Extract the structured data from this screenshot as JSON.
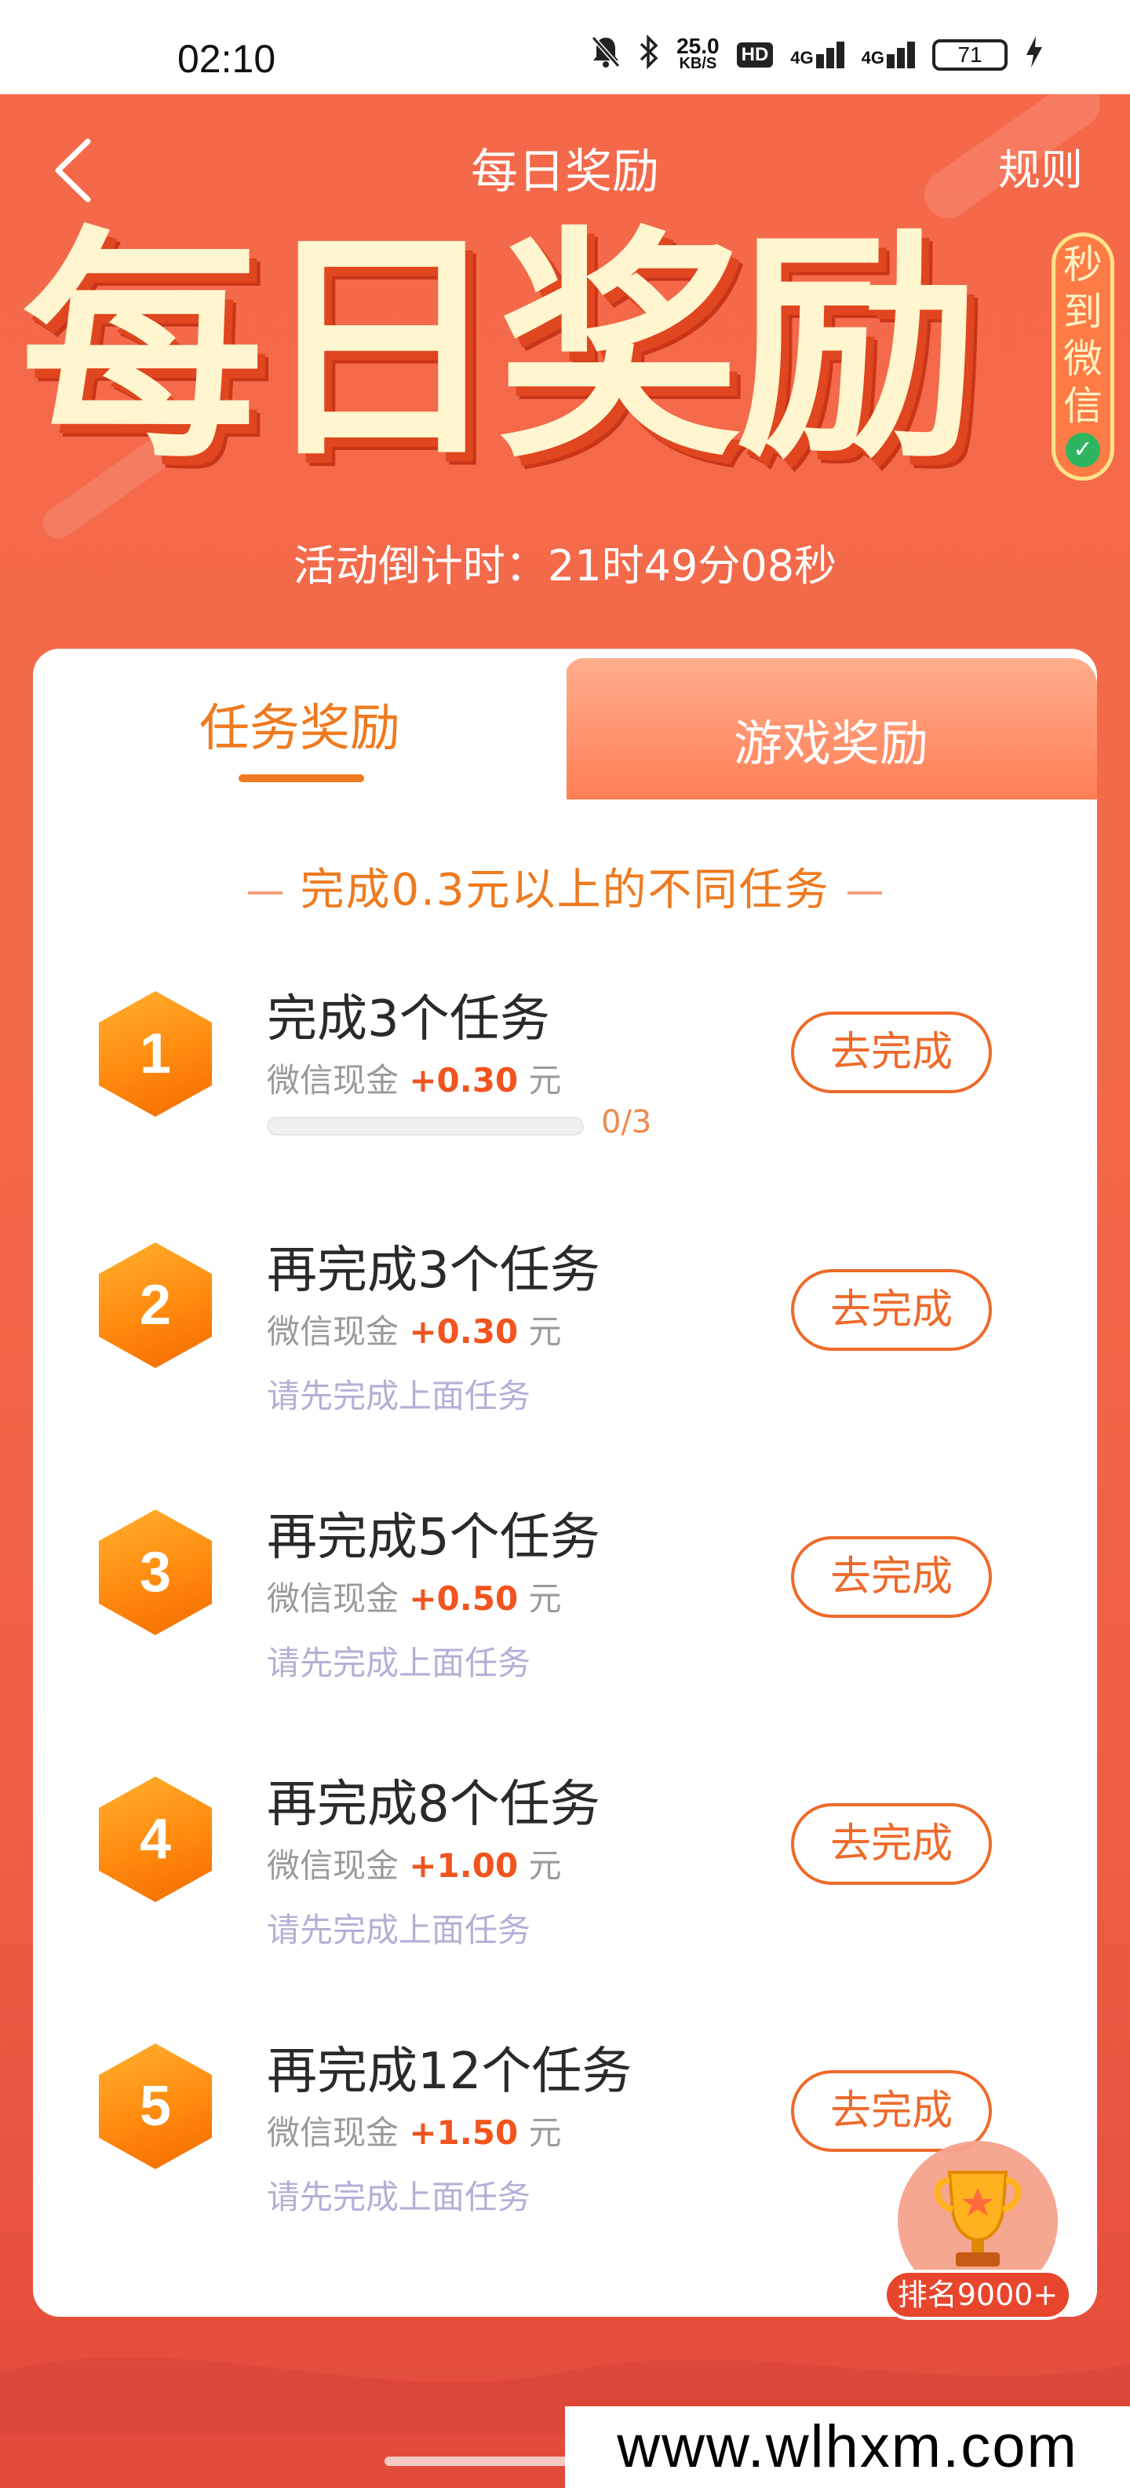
{
  "status_bar": {
    "time": "02:10",
    "net_speed_value": "25.0",
    "net_speed_unit": "KB/S",
    "hd_label": "HD",
    "signal_1": "4G",
    "signal_2": "4G",
    "battery": "71"
  },
  "header": {
    "title": "每日奖励",
    "rules_label": "规则"
  },
  "banner": {
    "title": "每日奖励",
    "badge_text": "秒到微信",
    "countdown": "活动倒计时：21时49分08秒"
  },
  "tabs": [
    {
      "label": "任务奖励",
      "active": true
    },
    {
      "label": "游戏奖励",
      "active": false
    }
  ],
  "section_subtitle": "完成0.3元以上的不同任务",
  "tasks": [
    {
      "number": "1",
      "title": "完成3个任务",
      "reward_prefix": "微信现金 ",
      "reward_amount": "+0.30",
      "reward_suffix": " 元",
      "progress_text": "0/3",
      "progress_fraction": 0,
      "button_label": "去完成"
    },
    {
      "number": "2",
      "title": "再完成3个任务",
      "reward_prefix": "微信现金 ",
      "reward_amount": "+0.30",
      "reward_suffix": " 元",
      "hint": "请先完成上面任务",
      "button_label": "去完成"
    },
    {
      "number": "3",
      "title": "再完成5个任务",
      "reward_prefix": "微信现金 ",
      "reward_amount": "+0.50",
      "reward_suffix": " 元",
      "hint": "请先完成上面任务",
      "button_label": "去完成"
    },
    {
      "number": "4",
      "title": "再完成8个任务",
      "reward_prefix": "微信现金 ",
      "reward_amount": "+1.00",
      "reward_suffix": " 元",
      "hint": "请先完成上面任务",
      "button_label": "去完成"
    },
    {
      "number": "5",
      "title": "再完成12个任务",
      "reward_prefix": "微信现金 ",
      "reward_amount": "+1.50",
      "reward_suffix": " 元",
      "hint": "请先完成上面任务",
      "button_label": "去完成"
    }
  ],
  "rank_float": {
    "label": "排名9000+",
    "icon": "trophy-icon"
  },
  "watermark": "www.wlhxm.com",
  "colors": {
    "background": "#f26a4a",
    "accent": "#ef7a1f",
    "reward_amount": "#f1541e",
    "hint": "#b7aed6"
  }
}
